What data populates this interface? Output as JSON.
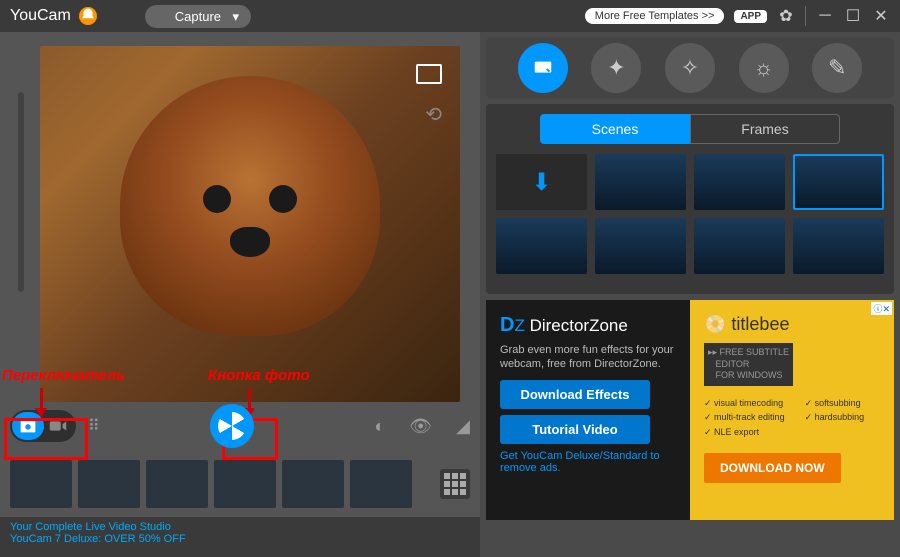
{
  "titlebar": {
    "app_name": "YouCam",
    "capture_label": "Capture",
    "more_templates": "More Free Templates  >>",
    "app_badge": "APP"
  },
  "annotations": {
    "switcher": "Переключатель",
    "photo_button": "Кнопка фото"
  },
  "promo": {
    "line1": "Your Complete Live Video Studio",
    "line2": "YouCam 7 Deluxe: OVER 50% OFF"
  },
  "panel": {
    "tab_scenes": "Scenes",
    "tab_frames": "Frames"
  },
  "directorzone": {
    "brand": "DirectorZone",
    "desc": "Grab even more fun effects for your webcam, free from DirectorZone.",
    "download_btn": "Download Effects",
    "tutorial_btn": "Tutorial Video",
    "remove_ads": "Get YouCam Deluxe/Standard to remove ads."
  },
  "titlebee": {
    "brand": "titlebee",
    "sub1": "FREE SUBTITLE",
    "sub2": "EDITOR",
    "sub3": "FOR WINDOWS",
    "f1": "visual timecoding",
    "f2": "multi-track editing",
    "f3": "NLE export",
    "f4": "softsubbing",
    "f5": "hardsubbing",
    "download": "DOWNLOAD NOW"
  }
}
